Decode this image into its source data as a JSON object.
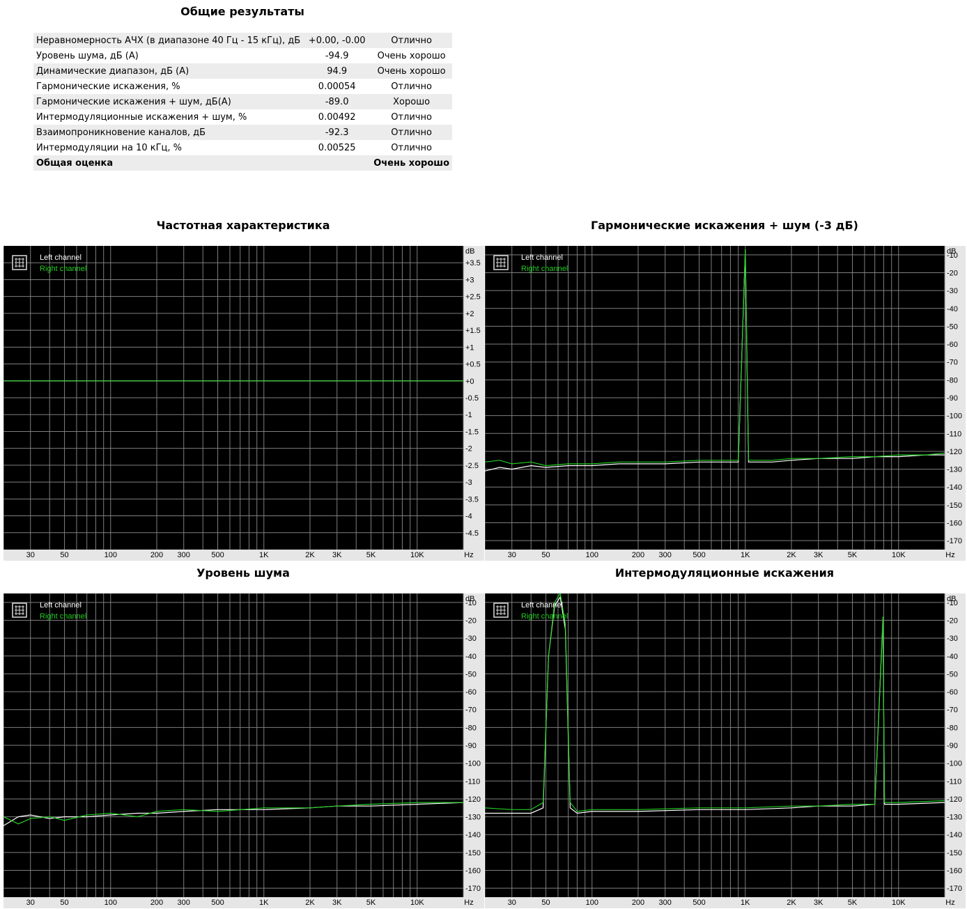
{
  "summary": {
    "title": "Общие результаты",
    "rows": [
      {
        "label": "Неравномерность АЧХ (в диапазоне 40 Гц - 15 кГц), дБ",
        "value": "+0.00, -0.00",
        "rating": "Отлично"
      },
      {
        "label": "Уровень шума, дБ (А)",
        "value": "-94.9",
        "rating": "Очень хорошо"
      },
      {
        "label": "Динамические диапазон, дБ (А)",
        "value": "94.9",
        "rating": "Очень хорошо"
      },
      {
        "label": "Гармонические искажения, %",
        "value": "0.00054",
        "rating": "Отлично"
      },
      {
        "label": "Гармонические искажения + шум, дБ(А)",
        "value": "-89.0",
        "rating": "Хорошо"
      },
      {
        "label": "Интермодуляционные искажения + шум, %",
        "value": "0.00492",
        "rating": "Отлично"
      },
      {
        "label": "Взаимопроникновение каналов, дБ",
        "value": "-92.3",
        "rating": "Отлично"
      },
      {
        "label": "Интермодуляции на 10 кГц, %",
        "value": "0.00525",
        "rating": "Отлично"
      }
    ],
    "total": {
      "label": "Общая оценка",
      "rating": "Очень хорошо"
    }
  },
  "colors": {
    "background": "#000000",
    "grid": "#7f7f7f",
    "left": "#ffffff",
    "right": "#22cc22",
    "axis_bg": "#e6e6e6"
  },
  "legend": {
    "left": "Left channel",
    "right": "Right channel",
    "icon": "grid-icon"
  },
  "x_axis": {
    "unit": "Hz",
    "ticks": [
      "30",
      "50",
      "100",
      "200",
      "300",
      "500",
      "1K",
      "2K",
      "3K",
      "5K",
      "10K"
    ],
    "tick_values": [
      30,
      50,
      100,
      200,
      300,
      500,
      1000,
      2000,
      3000,
      5000,
      10000
    ],
    "range": [
      20,
      20000
    ],
    "scale": "log"
  },
  "chart_data": [
    {
      "id": "fr",
      "type": "line",
      "title": "Частотная характеристика",
      "y_unit": "dB",
      "ylim": [
        -5,
        4
      ],
      "y_ticks": [
        "+3.5",
        "+3",
        "+2.5",
        "+2",
        "+1.5",
        "+1",
        "+0.5",
        "+0",
        "-0.5",
        "-1",
        "-1.5",
        "-2",
        "-2.5",
        "-3",
        "-3.5",
        "-4",
        "-4.5"
      ],
      "y_tick_values": [
        3.5,
        3,
        2.5,
        2,
        1.5,
        1,
        0.5,
        0,
        -0.5,
        -1,
        -1.5,
        -2,
        -2.5,
        -3,
        -3.5,
        -4,
        -4.5
      ],
      "series": [
        {
          "name": "Left channel",
          "points": [
            [
              20,
              0
            ],
            [
              100,
              0
            ],
            [
              1000,
              0
            ],
            [
              10000,
              0
            ],
            [
              20000,
              0
            ]
          ]
        },
        {
          "name": "Right channel",
          "points": [
            [
              20,
              0
            ],
            [
              100,
              0
            ],
            [
              1000,
              0
            ],
            [
              10000,
              0
            ],
            [
              20000,
              0
            ]
          ]
        }
      ]
    },
    {
      "id": "thd",
      "type": "line",
      "title": "Гармонические искажения + шум (-3 дБ)",
      "y_unit": "dB",
      "ylim": [
        -175,
        -5
      ],
      "y_ticks": [
        "-10",
        "-20",
        "-30",
        "-40",
        "-50",
        "-60",
        "-70",
        "-80",
        "-90",
        "-100",
        "-110",
        "-120",
        "-130",
        "-140",
        "-150",
        "-160",
        "-170"
      ],
      "y_tick_values": [
        -10,
        -20,
        -30,
        -40,
        -50,
        -60,
        -70,
        -80,
        -90,
        -100,
        -110,
        -120,
        -130,
        -140,
        -150,
        -160,
        -170
      ],
      "series": [
        {
          "name": "Left channel",
          "points": [
            [
              20,
              -131
            ],
            [
              25,
              -129
            ],
            [
              30,
              -130
            ],
            [
              40,
              -128
            ],
            [
              50,
              -129
            ],
            [
              70,
              -128
            ],
            [
              100,
              -128
            ],
            [
              150,
              -127
            ],
            [
              200,
              -127
            ],
            [
              300,
              -127
            ],
            [
              500,
              -126
            ],
            [
              700,
              -126
            ],
            [
              900,
              -126
            ],
            [
              1000,
              -7
            ],
            [
              1050,
              -126
            ],
            [
              1500,
              -126
            ],
            [
              2000,
              -125
            ],
            [
              3000,
              -124
            ],
            [
              5000,
              -124
            ],
            [
              7000,
              -123
            ],
            [
              10000,
              -123
            ],
            [
              15000,
              -122
            ],
            [
              20000,
              -122
            ]
          ]
        },
        {
          "name": "Right channel",
          "points": [
            [
              20,
              -126
            ],
            [
              25,
              -125
            ],
            [
              30,
              -127
            ],
            [
              40,
              -126
            ],
            [
              50,
              -128
            ],
            [
              70,
              -127
            ],
            [
              100,
              -127
            ],
            [
              150,
              -126
            ],
            [
              200,
              -126
            ],
            [
              300,
              -126
            ],
            [
              500,
              -125
            ],
            [
              700,
              -125
            ],
            [
              900,
              -125
            ],
            [
              1000,
              -7
            ],
            [
              1050,
              -125
            ],
            [
              1500,
              -125
            ],
            [
              2000,
              -124
            ],
            [
              3000,
              -124
            ],
            [
              5000,
              -123
            ],
            [
              7000,
              -123
            ],
            [
              10000,
              -122
            ],
            [
              15000,
              -122
            ],
            [
              20000,
              -121
            ]
          ]
        }
      ]
    },
    {
      "id": "noise",
      "type": "line",
      "title": "Уровень шума",
      "y_unit": "dB",
      "ylim": [
        -175,
        -5
      ],
      "y_ticks": [
        "-10",
        "-20",
        "-30",
        "-40",
        "-50",
        "-60",
        "-70",
        "-80",
        "-90",
        "-100",
        "-110",
        "-120",
        "-130",
        "-140",
        "-150",
        "-160",
        "-170"
      ],
      "y_tick_values": [
        -10,
        -20,
        -30,
        -40,
        -50,
        -60,
        -70,
        -80,
        -90,
        -100,
        -110,
        -120,
        -130,
        -140,
        -150,
        -160,
        -170
      ],
      "series": [
        {
          "name": "Left channel",
          "points": [
            [
              20,
              -135
            ],
            [
              25,
              -130
            ],
            [
              30,
              -129
            ],
            [
              40,
              -131
            ],
            [
              50,
              -130
            ],
            [
              70,
              -130
            ],
            [
              100,
              -129
            ],
            [
              150,
              -128
            ],
            [
              200,
              -128
            ],
            [
              300,
              -127
            ],
            [
              500,
              -126
            ],
            [
              1000,
              -126
            ],
            [
              2000,
              -125
            ],
            [
              3000,
              -124
            ],
            [
              5000,
              -124
            ],
            [
              10000,
              -123
            ],
            [
              20000,
              -122
            ]
          ]
        },
        {
          "name": "Right channel",
          "points": [
            [
              20,
              -130
            ],
            [
              25,
              -134
            ],
            [
              30,
              -131
            ],
            [
              40,
              -130
            ],
            [
              50,
              -132
            ],
            [
              70,
              -129
            ],
            [
              100,
              -128
            ],
            [
              150,
              -130
            ],
            [
              200,
              -127
            ],
            [
              300,
              -126
            ],
            [
              500,
              -127
            ],
            [
              1000,
              -125
            ],
            [
              2000,
              -125
            ],
            [
              3000,
              -124
            ],
            [
              5000,
              -123
            ],
            [
              10000,
              -122
            ],
            [
              20000,
              -122
            ]
          ]
        }
      ]
    },
    {
      "id": "imd",
      "type": "line",
      "title": "Интермодуляционные искажения",
      "y_unit": "dB",
      "ylim": [
        -175,
        -5
      ],
      "y_ticks": [
        "-10",
        "-20",
        "-30",
        "-40",
        "-50",
        "-60",
        "-70",
        "-80",
        "-90",
        "-100",
        "-110",
        "-120",
        "-130",
        "-140",
        "-150",
        "-160",
        "-170"
      ],
      "y_tick_values": [
        -10,
        -20,
        -30,
        -40,
        -50,
        -60,
        -70,
        -80,
        -90,
        -100,
        -110,
        -120,
        -130,
        -140,
        -150,
        -160,
        -170
      ],
      "series": [
        {
          "name": "Left channel",
          "points": [
            [
              20,
              -128
            ],
            [
              30,
              -128
            ],
            [
              40,
              -128
            ],
            [
              48,
              -125
            ],
            [
              52,
              -40
            ],
            [
              57,
              -12
            ],
            [
              62,
              -7
            ],
            [
              67,
              -25
            ],
            [
              72,
              -125
            ],
            [
              80,
              -128
            ],
            [
              100,
              -127
            ],
            [
              200,
              -127
            ],
            [
              500,
              -126
            ],
            [
              1000,
              -126
            ],
            [
              2000,
              -125
            ],
            [
              3000,
              -124
            ],
            [
              5000,
              -124
            ],
            [
              7000,
              -123
            ],
            [
              7900,
              -20
            ],
            [
              8100,
              -123
            ],
            [
              10000,
              -123
            ],
            [
              20000,
              -122
            ]
          ]
        },
        {
          "name": "Right channel",
          "points": [
            [
              20,
              -125
            ],
            [
              30,
              -126
            ],
            [
              40,
              -126
            ],
            [
              48,
              -122
            ],
            [
              52,
              -40
            ],
            [
              57,
              -10
            ],
            [
              62,
              -5
            ],
            [
              67,
              -22
            ],
            [
              72,
              -122
            ],
            [
              80,
              -127
            ],
            [
              100,
              -126
            ],
            [
              200,
              -126
            ],
            [
              500,
              -125
            ],
            [
              1000,
              -125
            ],
            [
              2000,
              -124
            ],
            [
              3000,
              -124
            ],
            [
              5000,
              -123
            ],
            [
              7000,
              -123
            ],
            [
              7900,
              -18
            ],
            [
              8100,
              -122
            ],
            [
              10000,
              -122
            ],
            [
              20000,
              -121
            ]
          ]
        }
      ]
    }
  ]
}
